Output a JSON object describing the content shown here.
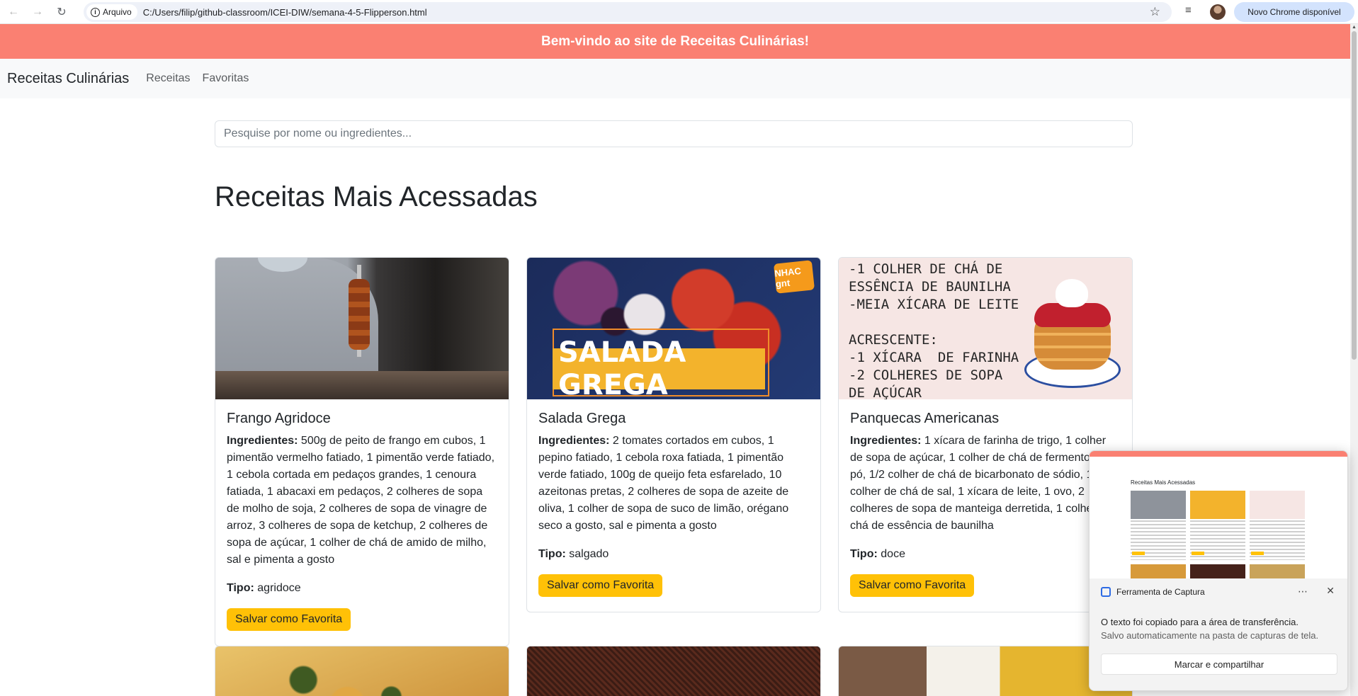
{
  "browser": {
    "back_icon": "arrow-left-icon",
    "forward_icon": "arrow-right-icon",
    "reload_icon": "reload-icon",
    "site_chip_label": "Arquivo",
    "url": "C:/Users/filip/github-classroom/ICEI-DIW/semana-4-5-Flipperson.html",
    "update_label": "Novo Chrome disponível"
  },
  "page": {
    "welcome": "Bem-vindo ao site de Receitas Culinárias!",
    "navbar": {
      "brand": "Receitas Culinárias",
      "links": [
        "Receitas",
        "Favoritas"
      ]
    },
    "search": {
      "placeholder": "Pesquise por nome ou ingredientes..."
    },
    "heading": "Receitas Mais Acessadas",
    "ingredients_label": "Ingredientes:",
    "type_label": "Tipo:",
    "save_label": "Salvar como Favorita",
    "recipes": [
      {
        "title": "Frango Agridoce",
        "ingredients": "500g de peito de frango em cubos, 1 pimentão vermelho fatiado, 1 pimentão verde fatiado, 1 cebola cortada em pedaços grandes, 1 cenoura fatiada, 1 abacaxi em pedaços, 2 colheres de sopa de molho de soja, 2 colheres de sopa de vinagre de arroz, 3 colheres de sopa de ketchup, 2 colheres de sopa de açúcar, 1 colher de chá de amido de milho, sal e pimenta a gosto",
        "type": "agridoce"
      },
      {
        "title": "Salada Grega",
        "ingredients": "2 tomates cortados em cubos, 1 pepino fatiado, 1 cebola roxa fatiada, 1 pimentão verde fatiado, 100g de queijo feta esfarelado, 10 azeitonas pretas, 2 colheres de sopa de azeite de oliva, 1 colher de sopa de suco de limão, orégano seco a gosto, sal e pimenta a gosto",
        "type": "salgado",
        "image_banner": "SALADA GREGA",
        "image_logo": "NHAC gnt"
      },
      {
        "title": "Panquecas Americanas",
        "ingredients": "1 xícara de farinha de trigo, 1 colher de sopa de açúcar, 1 colher de chá de fermento em pó, 1/2 colher de chá de bicarbonato de sódio, 1/4 colher de chá de sal, 1 xícara de leite, 1 ovo, 2 colheres de sopa de manteiga derretida, 1 colher de chá de essência de baunilha",
        "type": "doce",
        "image_text": "-1 COLHER DE CHÁ DE\nESSÊNCIA DE BAUNILHA\n-MEIA XÍCARA DE LEITE\n\nACRESCENTE:\n-1 XÍCARA  DE FARINHA\n-2 COLHERES DE SOPA\nDE AÇÚCAR"
      }
    ]
  },
  "toast": {
    "app_name": "Ferramenta de Captura",
    "thumb_heading": "Receitas Mais Acessadas",
    "message": "O texto foi copiado para a área de transferência.",
    "sub_message": "Salvo automaticamente na pasta de capturas de tela.",
    "action_label": "Marcar e compartilhar",
    "more_icon": "more-icon",
    "close_icon": "close-icon"
  }
}
